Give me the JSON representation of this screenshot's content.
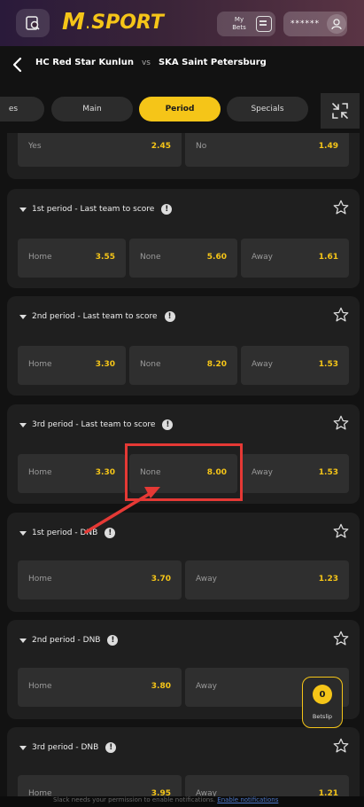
{
  "header": {
    "logo_m": "M",
    "logo_sport": "SPORT",
    "my_bets_label": "My Bets",
    "account_masked": "******"
  },
  "match": {
    "home": "HC Red Star Kunlun",
    "vs": "vs",
    "away": "SKA Saint Petersburg"
  },
  "tabs": [
    {
      "label": "es",
      "active": false
    },
    {
      "label": "Main",
      "active": false
    },
    {
      "label": "Period",
      "active": true
    },
    {
      "label": "Specials",
      "active": false
    }
  ],
  "markets": [
    {
      "title": "",
      "selections": [
        {
          "name": "Yes",
          "odds": "2.45"
        },
        {
          "name": "No",
          "odds": "1.49"
        }
      ]
    },
    {
      "title": "1st period - Last team to score",
      "selections": [
        {
          "name": "Home",
          "odds": "3.55"
        },
        {
          "name": "None",
          "odds": "5.60"
        },
        {
          "name": "Away",
          "odds": "1.61"
        }
      ]
    },
    {
      "title": "2nd period - Last team to score",
      "selections": [
        {
          "name": "Home",
          "odds": "3.30"
        },
        {
          "name": "None",
          "odds": "8.20"
        },
        {
          "name": "Away",
          "odds": "1.53"
        }
      ]
    },
    {
      "title": "3rd period - Last team to score",
      "selections": [
        {
          "name": "Home",
          "odds": "3.30"
        },
        {
          "name": "None",
          "odds": "8.00"
        },
        {
          "name": "Away",
          "odds": "1.53"
        }
      ]
    },
    {
      "title": "1st period - DNB",
      "selections": [
        {
          "name": "Home",
          "odds": "3.70"
        },
        {
          "name": "Away",
          "odds": "1.23"
        }
      ]
    },
    {
      "title": "2nd period - DNB",
      "selections": [
        {
          "name": "Home",
          "odds": "3.80"
        },
        {
          "name": "Away",
          "odds": ""
        }
      ]
    },
    {
      "title": "3rd period - DNB",
      "selections": [
        {
          "name": "Home",
          "odds": "3.95"
        },
        {
          "name": "Away",
          "odds": "1.21"
        }
      ]
    }
  ],
  "betslip": {
    "count": "0",
    "label": "Betslip"
  },
  "notice": {
    "text": "Slack needs your permission to enable notifications.",
    "link": "Enable notifications"
  },
  "colors": {
    "accent": "#f5c518",
    "annotation": "#e53935",
    "card": "#1f1f1f",
    "cell": "#2f2f2f"
  }
}
